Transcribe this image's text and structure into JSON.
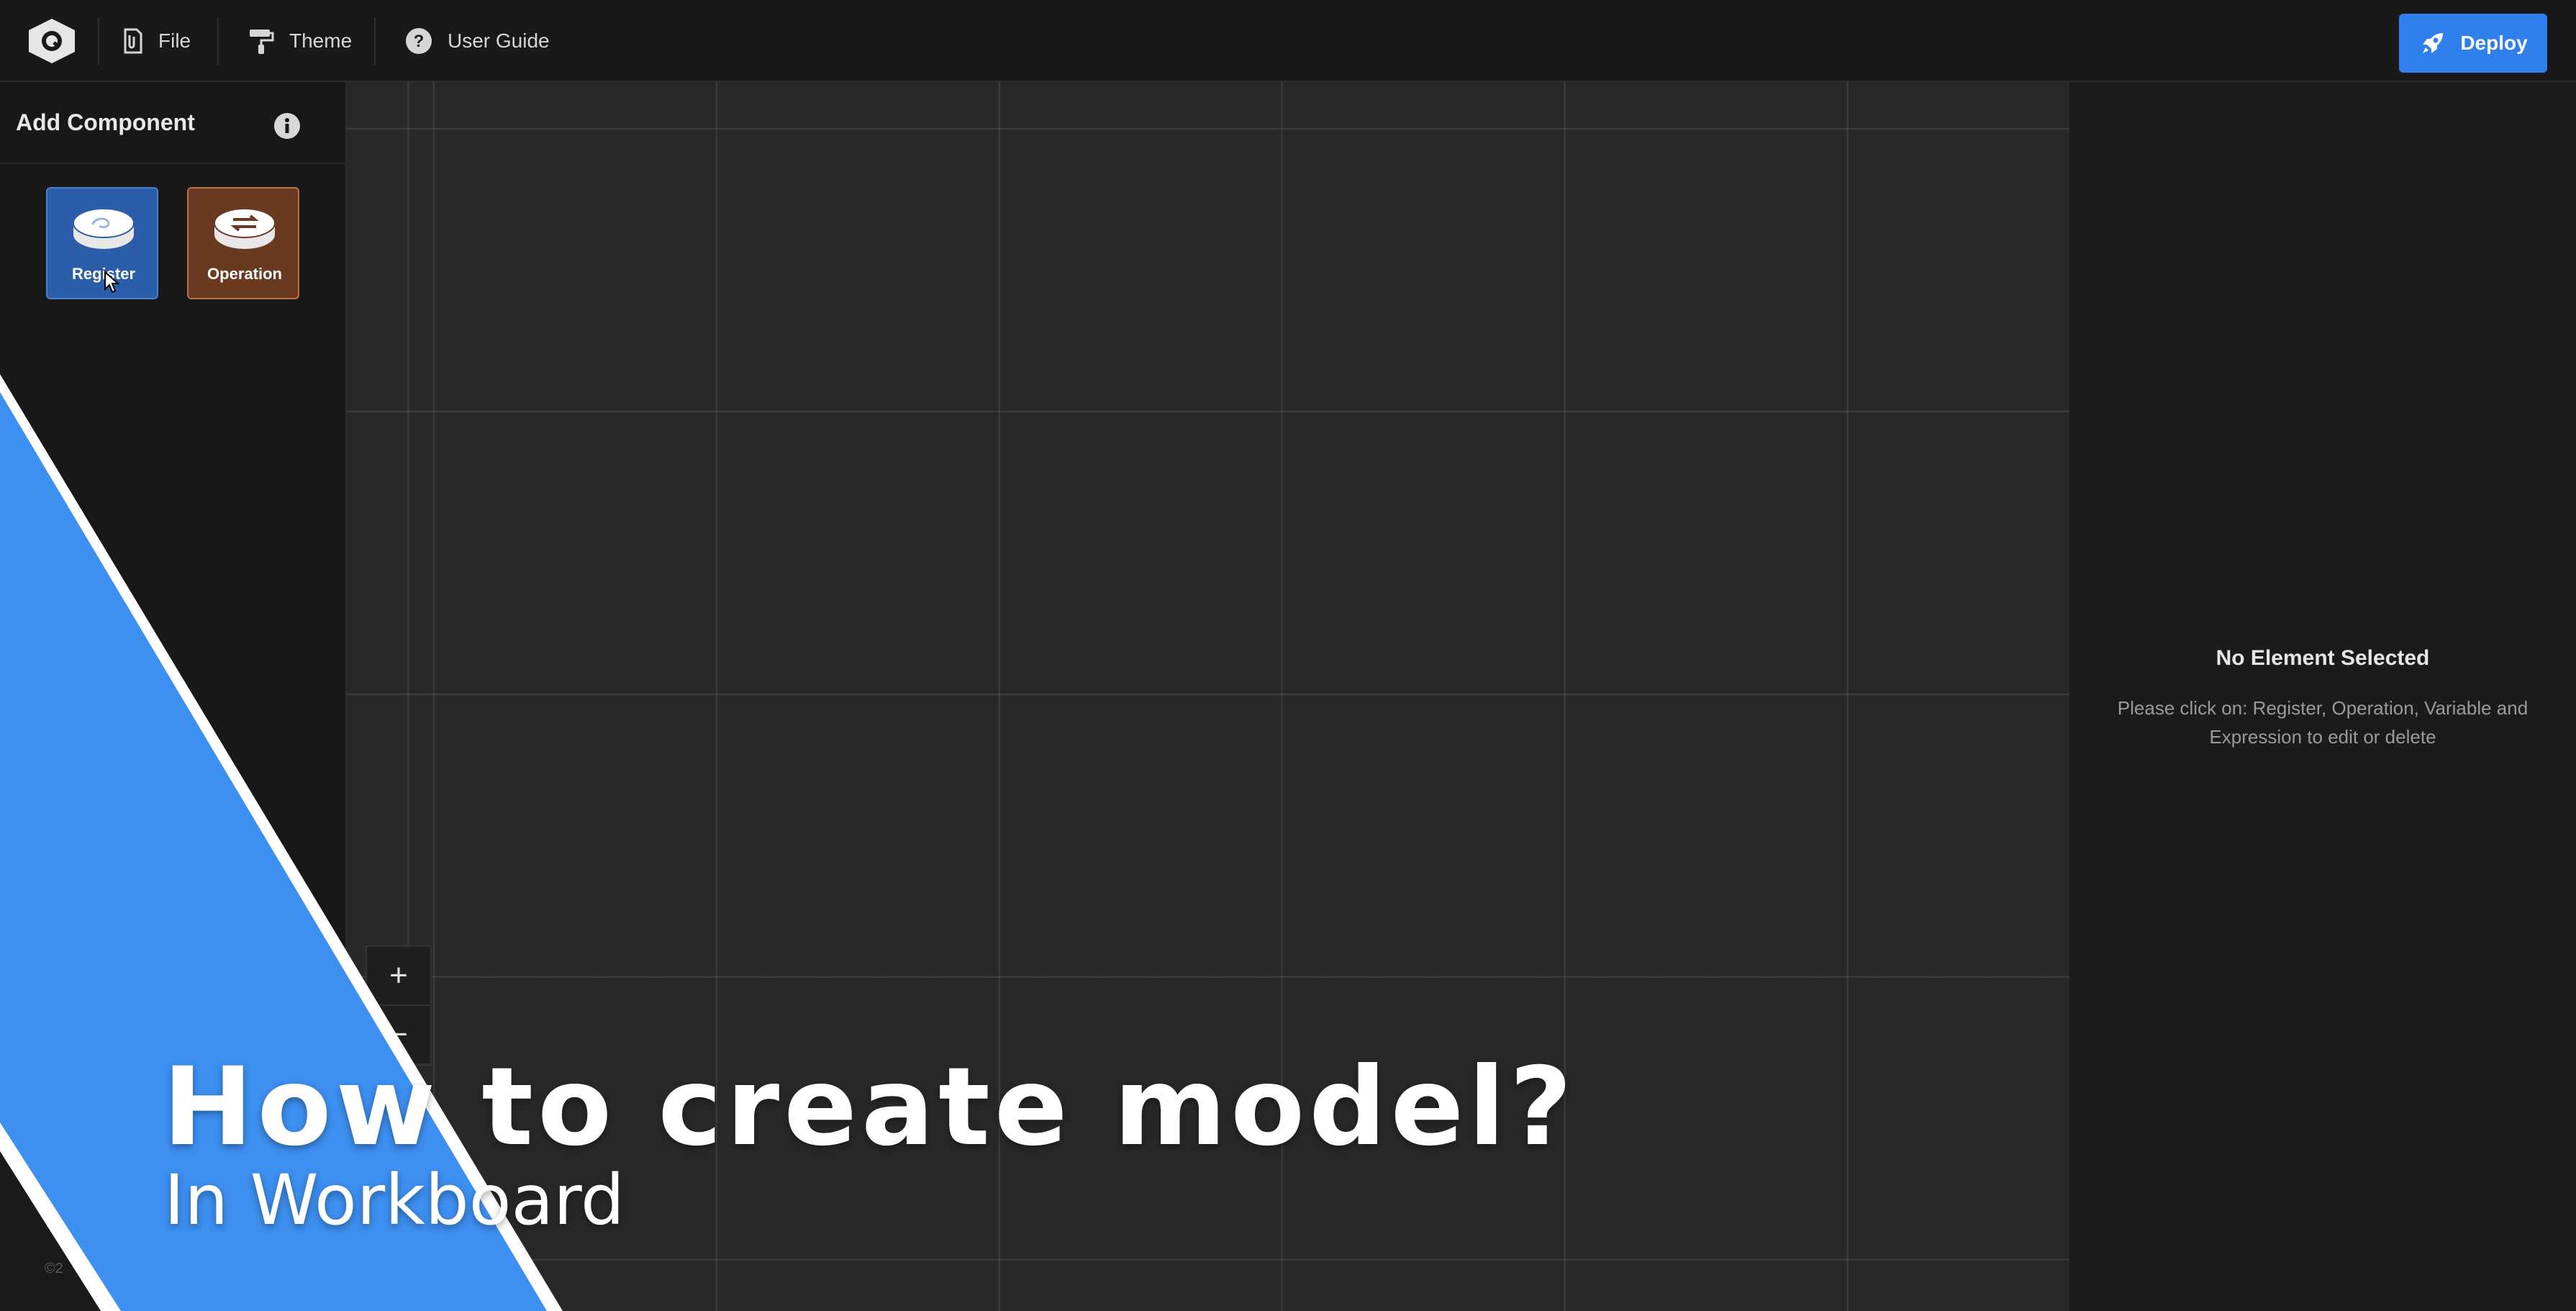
{
  "topbar": {
    "logo_icon": "q-hexagon-logo",
    "nav": [
      {
        "label": "File",
        "icon": "paperclip-file-icon"
      },
      {
        "label": "Theme",
        "icon": "paint-roller-icon"
      },
      {
        "label": "User Guide",
        "icon": "question-circle-icon"
      }
    ],
    "deploy_label": "Deploy",
    "deploy_icon": "rocket-icon",
    "deploy_color": "#2f80ed"
  },
  "sidebar": {
    "title": "Add Component",
    "info_icon": "info-icon",
    "components": [
      {
        "label": "Register",
        "color": "#2c5da8"
      },
      {
        "label": "Operation",
        "color": "#6a3a20"
      }
    ]
  },
  "canvas": {
    "zoom_in": "+",
    "zoom_out": "−"
  },
  "inspector": {
    "title": "No Element Selected",
    "description": "Please click on: Register, Operation, Variable and Expression to edit or delete"
  },
  "overlay": {
    "title": "How to create model?",
    "subtitle": "In Workboard",
    "copyright": "©2",
    "accent_color": "#3d8ff0"
  }
}
